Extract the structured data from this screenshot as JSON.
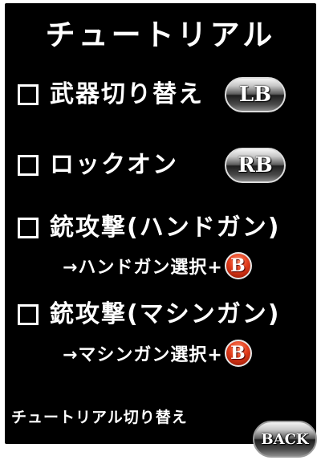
{
  "title": "チュートリアル",
  "items": [
    {
      "label": "武器切り替え",
      "button": "LB"
    },
    {
      "label": "ロックオン",
      "button": "RB"
    },
    {
      "label": "銃攻撃(ハンドガン)",
      "hint": "→ハンドガン選択+",
      "hint_button": "B"
    },
    {
      "label": "銃攻撃(マシンガン)",
      "hint": "→マシンガン選択+",
      "hint_button": "B"
    }
  ],
  "footer": {
    "toggle_label": "チュートリアル切り替え",
    "back_label": "BACK"
  },
  "colors": {
    "background": "#000000",
    "text": "#ffffff",
    "b_button": "#e23c1c"
  }
}
